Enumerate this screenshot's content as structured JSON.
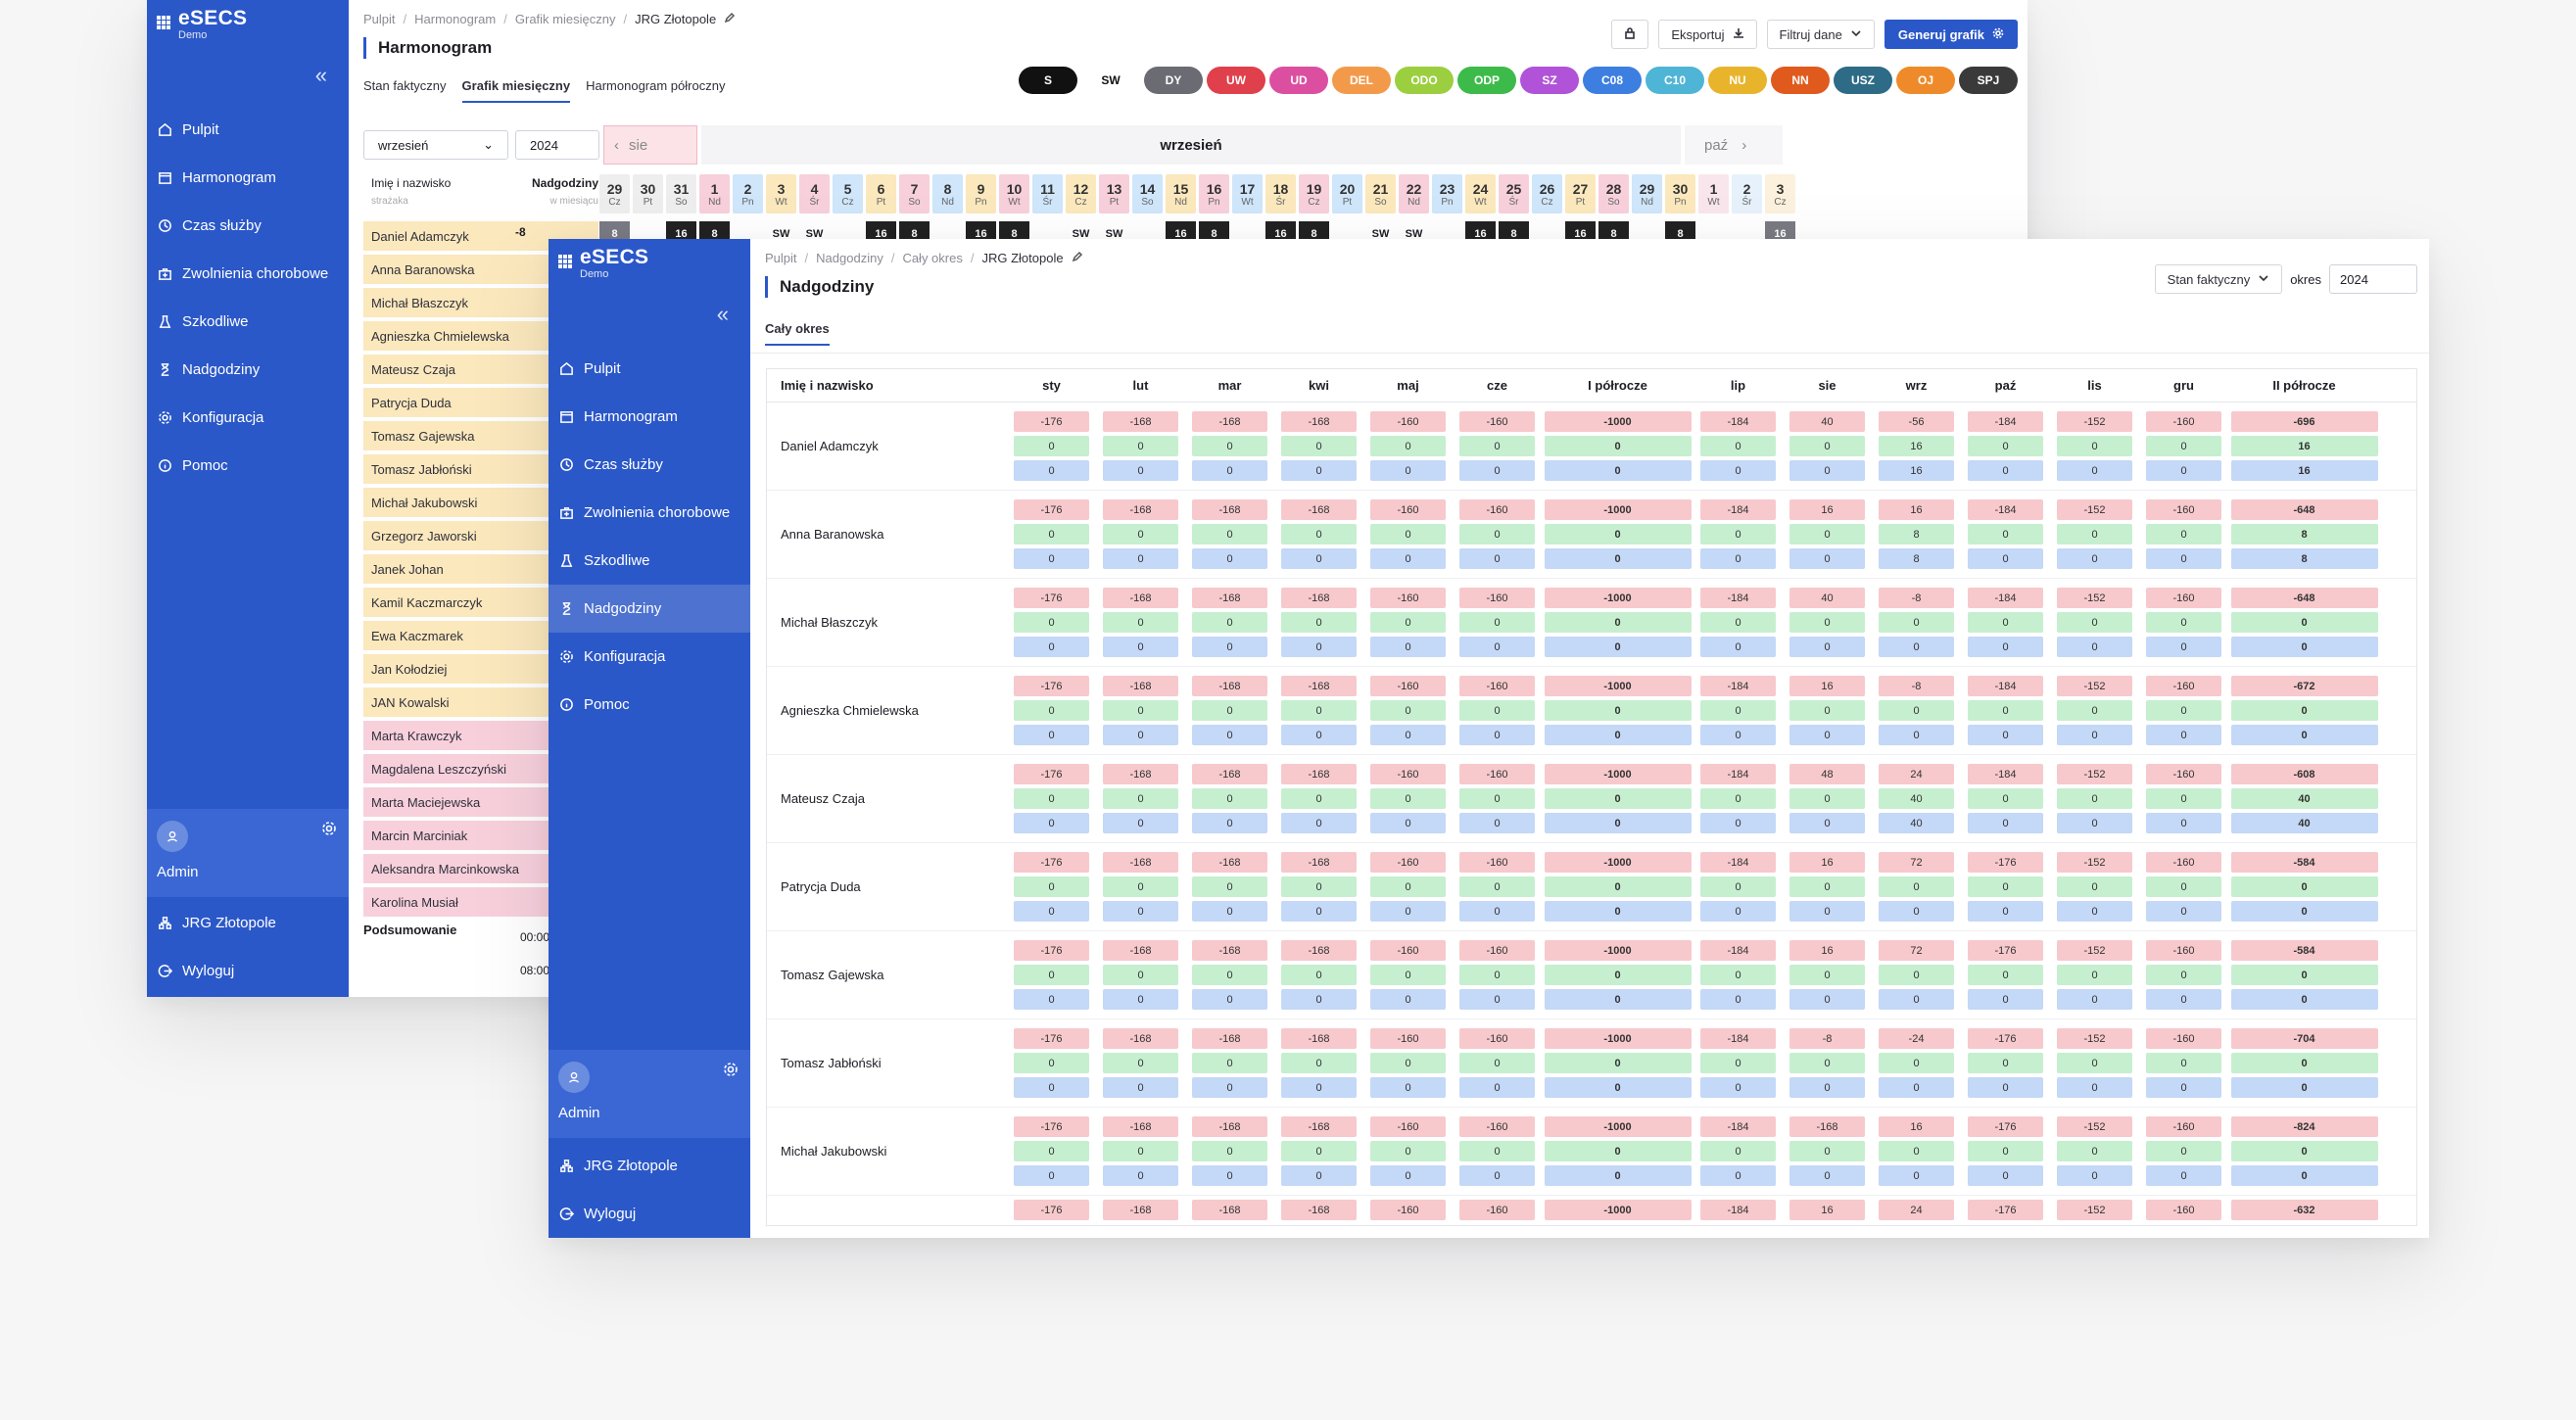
{
  "brand": {
    "name": "eSECS",
    "sub": "Demo"
  },
  "nav": [
    "Pulpit",
    "Harmonogram",
    "Czas służby",
    "Zwolnienia chorobowe",
    "Szkodliwe",
    "Nadgodziny",
    "Konfiguracja",
    "Pomoc"
  ],
  "admin": {
    "name": "Admin"
  },
  "bottom_nav": [
    "JRG Złotopole",
    "Wyloguj"
  ],
  "win1": {
    "breadcrumb": [
      "Pulpit",
      "Harmonogram",
      "Grafik miesięczny",
      "JRG Złotopole"
    ],
    "title": "Harmonogram",
    "tabs": [
      "Stan faktyczny",
      "Grafik miesięczny",
      "Harmonogram półroczny"
    ],
    "export_label": "Eksportuj",
    "filter_label": "Filtruj dane",
    "generate_label": "Generuj grafik",
    "pills": [
      {
        "label": "S",
        "color": "#111111"
      },
      {
        "label": "SW",
        "color": "#ffffff"
      },
      {
        "label": "DY",
        "color": "#6b6b73"
      },
      {
        "label": "UW",
        "color": "#e0404b"
      },
      {
        "label": "UD",
        "color": "#dc4fa0"
      },
      {
        "label": "DEL",
        "color": "#f39a4a"
      },
      {
        "label": "ODO",
        "color": "#9bcf3f"
      },
      {
        "label": "ODP",
        "color": "#3dbb4a"
      },
      {
        "label": "SZ",
        "color": "#b053d8"
      },
      {
        "label": "C08",
        "color": "#3d7fe0"
      },
      {
        "label": "C10",
        "color": "#4fb5d6"
      },
      {
        "label": "NU",
        "color": "#e8b42b"
      },
      {
        "label": "NN",
        "color": "#e05a1e"
      },
      {
        "label": "USZ",
        "color": "#2e6b86"
      },
      {
        "label": "OJ",
        "color": "#ef8a2a"
      },
      {
        "label": "SPJ",
        "color": "#3a3a3a"
      }
    ],
    "month_select": "wrzesień",
    "year": "2024",
    "prev_month": "sie",
    "current_month": "wrzesień",
    "next_month": "paź",
    "name_header": "Imię i nazwisko",
    "name_sub": "strażaka",
    "overtime_header": "Nadgodziny",
    "overtime_sub": "w miesiącu",
    "days": [
      {
        "n": "29",
        "d": "Cz",
        "c": "#eeeeee"
      },
      {
        "n": "30",
        "d": "Pt",
        "c": "#eeeeee"
      },
      {
        "n": "31",
        "d": "So",
        "c": "#eeeeee"
      },
      {
        "n": "1",
        "d": "Nd",
        "c": "#f7d0dc"
      },
      {
        "n": "2",
        "d": "Pn",
        "c": "#cfe6fb"
      },
      {
        "n": "3",
        "d": "Wt",
        "c": "#fbe8bd"
      },
      {
        "n": "4",
        "d": "Śr",
        "c": "#f7d0dc"
      },
      {
        "n": "5",
        "d": "Cz",
        "c": "#cfe6fb"
      },
      {
        "n": "6",
        "d": "Pt",
        "c": "#fbe8bd"
      },
      {
        "n": "7",
        "d": "So",
        "c": "#f7d0dc"
      },
      {
        "n": "8",
        "d": "Nd",
        "c": "#cfe6fb"
      },
      {
        "n": "9",
        "d": "Pn",
        "c": "#fbe8bd"
      },
      {
        "n": "10",
        "d": "Wt",
        "c": "#f7d0dc"
      },
      {
        "n": "11",
        "d": "Śr",
        "c": "#cfe6fb"
      },
      {
        "n": "12",
        "d": "Cz",
        "c": "#fbe8bd"
      },
      {
        "n": "13",
        "d": "Pt",
        "c": "#f7d0dc"
      },
      {
        "n": "14",
        "d": "So",
        "c": "#cfe6fb"
      },
      {
        "n": "15",
        "d": "Nd",
        "c": "#fbe8bd"
      },
      {
        "n": "16",
        "d": "Pn",
        "c": "#f7d0dc"
      },
      {
        "n": "17",
        "d": "Wt",
        "c": "#cfe6fb"
      },
      {
        "n": "18",
        "d": "Śr",
        "c": "#fbe8bd"
      },
      {
        "n": "19",
        "d": "Cz",
        "c": "#f7d0dc"
      },
      {
        "n": "20",
        "d": "Pt",
        "c": "#cfe6fb"
      },
      {
        "n": "21",
        "d": "So",
        "c": "#fbe8bd"
      },
      {
        "n": "22",
        "d": "Nd",
        "c": "#f7d0dc"
      },
      {
        "n": "23",
        "d": "Pn",
        "c": "#cfe6fb"
      },
      {
        "n": "24",
        "d": "Wt",
        "c": "#fbe8bd"
      },
      {
        "n": "25",
        "d": "Śr",
        "c": "#f7d0dc"
      },
      {
        "n": "26",
        "d": "Cz",
        "c": "#cfe6fb"
      },
      {
        "n": "27",
        "d": "Pt",
        "c": "#fbe8bd"
      },
      {
        "n": "28",
        "d": "So",
        "c": "#f7d0dc"
      },
      {
        "n": "29",
        "d": "Nd",
        "c": "#cfe6fb"
      },
      {
        "n": "30",
        "d": "Pn",
        "c": "#fbe8bd"
      },
      {
        "n": "1",
        "d": "Wt",
        "c": "#f9e6ec"
      },
      {
        "n": "2",
        "d": "Śr",
        "c": "#e6f1fb"
      },
      {
        "n": "3",
        "d": "Cz",
        "c": "#fbf1dc"
      }
    ],
    "first_row_shifts": [
      {
        "t": "8",
        "k": "grey"
      },
      {
        "t": "",
        "k": ""
      },
      {
        "t": "16",
        "k": "dark"
      },
      {
        "t": "8",
        "k": "dark"
      },
      {
        "t": "",
        "k": ""
      },
      {
        "t": "SW",
        "k": ""
      },
      {
        "t": "SW",
        "k": ""
      },
      {
        "t": "",
        "k": ""
      },
      {
        "t": "16",
        "k": "dark"
      },
      {
        "t": "8",
        "k": "dark"
      },
      {
        "t": "",
        "k": ""
      },
      {
        "t": "16",
        "k": "dark"
      },
      {
        "t": "8",
        "k": "dark"
      },
      {
        "t": "",
        "k": ""
      },
      {
        "t": "SW",
        "k": ""
      },
      {
        "t": "SW",
        "k": ""
      },
      {
        "t": "",
        "k": ""
      },
      {
        "t": "16",
        "k": "dark"
      },
      {
        "t": "8",
        "k": "dark"
      },
      {
        "t": "",
        "k": ""
      },
      {
        "t": "16",
        "k": "dark"
      },
      {
        "t": "8",
        "k": "dark"
      },
      {
        "t": "",
        "k": ""
      },
      {
        "t": "SW",
        "k": ""
      },
      {
        "t": "SW",
        "k": ""
      },
      {
        "t": "",
        "k": ""
      },
      {
        "t": "16",
        "k": "dark"
      },
      {
        "t": "8",
        "k": "dark"
      },
      {
        "t": "",
        "k": ""
      },
      {
        "t": "16",
        "k": "dark"
      },
      {
        "t": "8",
        "k": "dark"
      },
      {
        "t": "",
        "k": ""
      },
      {
        "t": "8",
        "k": "dark"
      },
      {
        "t": "",
        "k": ""
      },
      {
        "t": "",
        "k": ""
      },
      {
        "t": "16",
        "k": "grey"
      }
    ],
    "first_row_overtime": "-8",
    "employees": [
      {
        "name": "Daniel Adamczyk",
        "c": "#fbe8bd"
      },
      {
        "name": "Anna Baranowska",
        "c": "#fbe8bd"
      },
      {
        "name": "Michał Błaszczyk",
        "c": "#fbe8bd"
      },
      {
        "name": "Agnieszka Chmielewska",
        "c": "#fbe8bd"
      },
      {
        "name": "Mateusz Czaja",
        "c": "#fbe8bd"
      },
      {
        "name": "Patrycja Duda",
        "c": "#fbe8bd"
      },
      {
        "name": "Tomasz Gajewska",
        "c": "#fbe8bd"
      },
      {
        "name": "Tomasz Jabłoński",
        "c": "#fbe8bd"
      },
      {
        "name": "Michał Jakubowski",
        "c": "#fbe8bd"
      },
      {
        "name": "Grzegorz Jaworski",
        "c": "#fbe8bd"
      },
      {
        "name": "Janek Johan",
        "c": "#fbe8bd"
      },
      {
        "name": "Kamil Kaczmarczyk",
        "c": "#fbe8bd"
      },
      {
        "name": "Ewa Kaczmarek",
        "c": "#fbe8bd"
      },
      {
        "name": "Jan Kołodziej",
        "c": "#fbe8bd"
      },
      {
        "name": "JAN Kowalski",
        "c": "#fbe8bd"
      },
      {
        "name": "Marta Krawczyk",
        "c": "#f7d0dc"
      },
      {
        "name": "Magdalena Leszczyński",
        "c": "#f7d0dc"
      },
      {
        "name": "Marta Maciejewska",
        "c": "#f7d0dc"
      },
      {
        "name": "Marcin Marciniak",
        "c": "#f7d0dc"
      },
      {
        "name": "Aleksandra Marcinkowska",
        "c": "#f7d0dc"
      },
      {
        "name": "Karolina Musiał",
        "c": "#f7d0dc"
      }
    ],
    "summary_label": "Podsumowanie",
    "summary_times": [
      "00:00",
      "08:00"
    ]
  },
  "win2": {
    "breadcrumb": [
      "Pulpit",
      "Nadgodziny",
      "Cały okres",
      "JRG Złotopole"
    ],
    "title": "Nadgodziny",
    "tab": "Cały okres",
    "status_select": "Stan faktyczny",
    "period_label": "okres",
    "year": "2024",
    "columns": [
      "Imię i nazwisko",
      "sty",
      "lut",
      "mar",
      "kwi",
      "maj",
      "cze",
      "I półrocze",
      "lip",
      "sie",
      "wrz",
      "paź",
      "lis",
      "gru",
      "II półrocze"
    ],
    "rows": [
      {
        "name": "Daniel Adamczyk",
        "red": [
          "-176",
          "-168",
          "-168",
          "-168",
          "-160",
          "-160",
          "-1000",
          "-184",
          "40",
          "-56",
          "-184",
          "-152",
          "-160",
          "-696"
        ],
        "green": [
          "0",
          "0",
          "0",
          "0",
          "0",
          "0",
          "0",
          "0",
          "0",
          "16",
          "0",
          "0",
          "0",
          "16"
        ]
      },
      {
        "name": "Anna Baranowska",
        "red": [
          "-176",
          "-168",
          "-168",
          "-168",
          "-160",
          "-160",
          "-1000",
          "-184",
          "16",
          "16",
          "-184",
          "-152",
          "-160",
          "-648"
        ],
        "green": [
          "0",
          "0",
          "0",
          "0",
          "0",
          "0",
          "0",
          "0",
          "0",
          "8",
          "0",
          "0",
          "0",
          "8"
        ]
      },
      {
        "name": "Michał Błaszczyk",
        "red": [
          "-176",
          "-168",
          "-168",
          "-168",
          "-160",
          "-160",
          "-1000",
          "-184",
          "40",
          "-8",
          "-184",
          "-152",
          "-160",
          "-648"
        ],
        "green": [
          "0",
          "0",
          "0",
          "0",
          "0",
          "0",
          "0",
          "0",
          "0",
          "0",
          "0",
          "0",
          "0",
          "0"
        ]
      },
      {
        "name": "Agnieszka Chmielewska",
        "red": [
          "-176",
          "-168",
          "-168",
          "-168",
          "-160",
          "-160",
          "-1000",
          "-184",
          "16",
          "-8",
          "-184",
          "-152",
          "-160",
          "-672"
        ],
        "green": [
          "0",
          "0",
          "0",
          "0",
          "0",
          "0",
          "0",
          "0",
          "0",
          "0",
          "0",
          "0",
          "0",
          "0"
        ]
      },
      {
        "name": "Mateusz Czaja",
        "red": [
          "-176",
          "-168",
          "-168",
          "-168",
          "-160",
          "-160",
          "-1000",
          "-184",
          "48",
          "24",
          "-184",
          "-152",
          "-160",
          "-608"
        ],
        "green": [
          "0",
          "0",
          "0",
          "0",
          "0",
          "0",
          "0",
          "0",
          "0",
          "40",
          "0",
          "0",
          "0",
          "40"
        ]
      },
      {
        "name": "Patrycja Duda",
        "red": [
          "-176",
          "-168",
          "-168",
          "-168",
          "-160",
          "-160",
          "-1000",
          "-184",
          "16",
          "72",
          "-176",
          "-152",
          "-160",
          "-584"
        ],
        "green": [
          "0",
          "0",
          "0",
          "0",
          "0",
          "0",
          "0",
          "0",
          "0",
          "0",
          "0",
          "0",
          "0",
          "0"
        ]
      },
      {
        "name": "Tomasz Gajewska",
        "red": [
          "-176",
          "-168",
          "-168",
          "-168",
          "-160",
          "-160",
          "-1000",
          "-184",
          "16",
          "72",
          "-176",
          "-152",
          "-160",
          "-584"
        ],
        "green": [
          "0",
          "0",
          "0",
          "0",
          "0",
          "0",
          "0",
          "0",
          "0",
          "0",
          "0",
          "0",
          "0",
          "0"
        ]
      },
      {
        "name": "Tomasz Jabłoński",
        "red": [
          "-176",
          "-168",
          "-168",
          "-168",
          "-160",
          "-160",
          "-1000",
          "-184",
          "-8",
          "-24",
          "-176",
          "-152",
          "-160",
          "-704"
        ],
        "green": [
          "0",
          "0",
          "0",
          "0",
          "0",
          "0",
          "0",
          "0",
          "0",
          "0",
          "0",
          "0",
          "0",
          "0"
        ]
      },
      {
        "name": "Michał Jakubowski",
        "red": [
          "-176",
          "-168",
          "-168",
          "-168",
          "-160",
          "-160",
          "-1000",
          "-184",
          "-168",
          "16",
          "-176",
          "-152",
          "-160",
          "-824"
        ],
        "green": [
          "0",
          "0",
          "0",
          "0",
          "0",
          "0",
          "0",
          "0",
          "0",
          "0",
          "0",
          "0",
          "0",
          "0"
        ]
      },
      {
        "name": "",
        "red": [
          "-176",
          "-168",
          "-168",
          "-168",
          "-160",
          "-160",
          "-1000",
          "-184",
          "16",
          "24",
          "-176",
          "-152",
          "-160",
          "-632"
        ],
        "green": []
      }
    ]
  }
}
